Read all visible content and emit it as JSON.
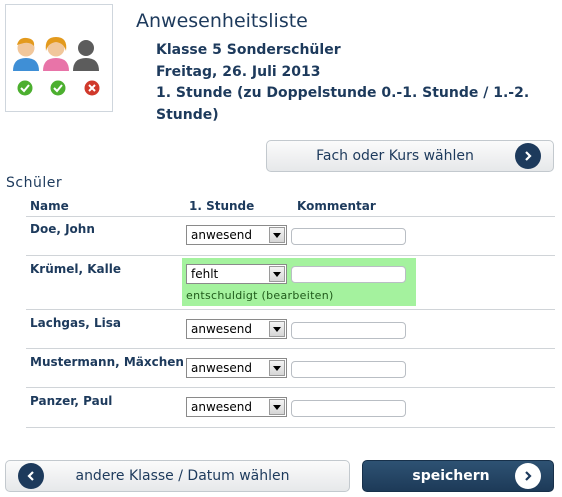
{
  "header": {
    "title": "Anwesenheitsliste",
    "class_name": "Klasse 5 Sonderschüler",
    "date": "Freitag, 26. Juli 2013",
    "lesson": "1. Stunde (zu Doppelstunde 0.-1. Stunde / 1.-2. Stunde)"
  },
  "buttons": {
    "subject": "Fach oder Kurs wählen",
    "other_class": "andere Klasse / Datum wählen",
    "save": "speichern"
  },
  "section_label": "Schüler",
  "table": {
    "headers": [
      "Name",
      "1. Stunde",
      "Kommentar"
    ],
    "rows": [
      {
        "name": "Doe, John",
        "status": "anwesend",
        "comment": "",
        "note": ""
      },
      {
        "name": "Krümel, Kalle",
        "status": "fehlt",
        "comment": "",
        "note": "entschuldigt (bearbeiten)"
      },
      {
        "name": "Lachgas, Lisa",
        "status": "anwesend",
        "comment": "",
        "note": ""
      },
      {
        "name": "Mustermann, Mäxchen",
        "status": "anwesend",
        "comment": "",
        "note": ""
      },
      {
        "name": "Panzer, Paul",
        "status": "anwesend",
        "comment": "",
        "note": ""
      }
    ]
  },
  "colors": {
    "navy": "#1d3a5c",
    "highlight_green": "#a4f29e",
    "check_green": "#4caf2f",
    "cross_red": "#d0392b"
  },
  "icons": [
    "attendance-logo",
    "checkmark-icon",
    "cross-icon",
    "chevron-right-icon",
    "chevron-left-icon",
    "dropdown-arrow-icon"
  ]
}
